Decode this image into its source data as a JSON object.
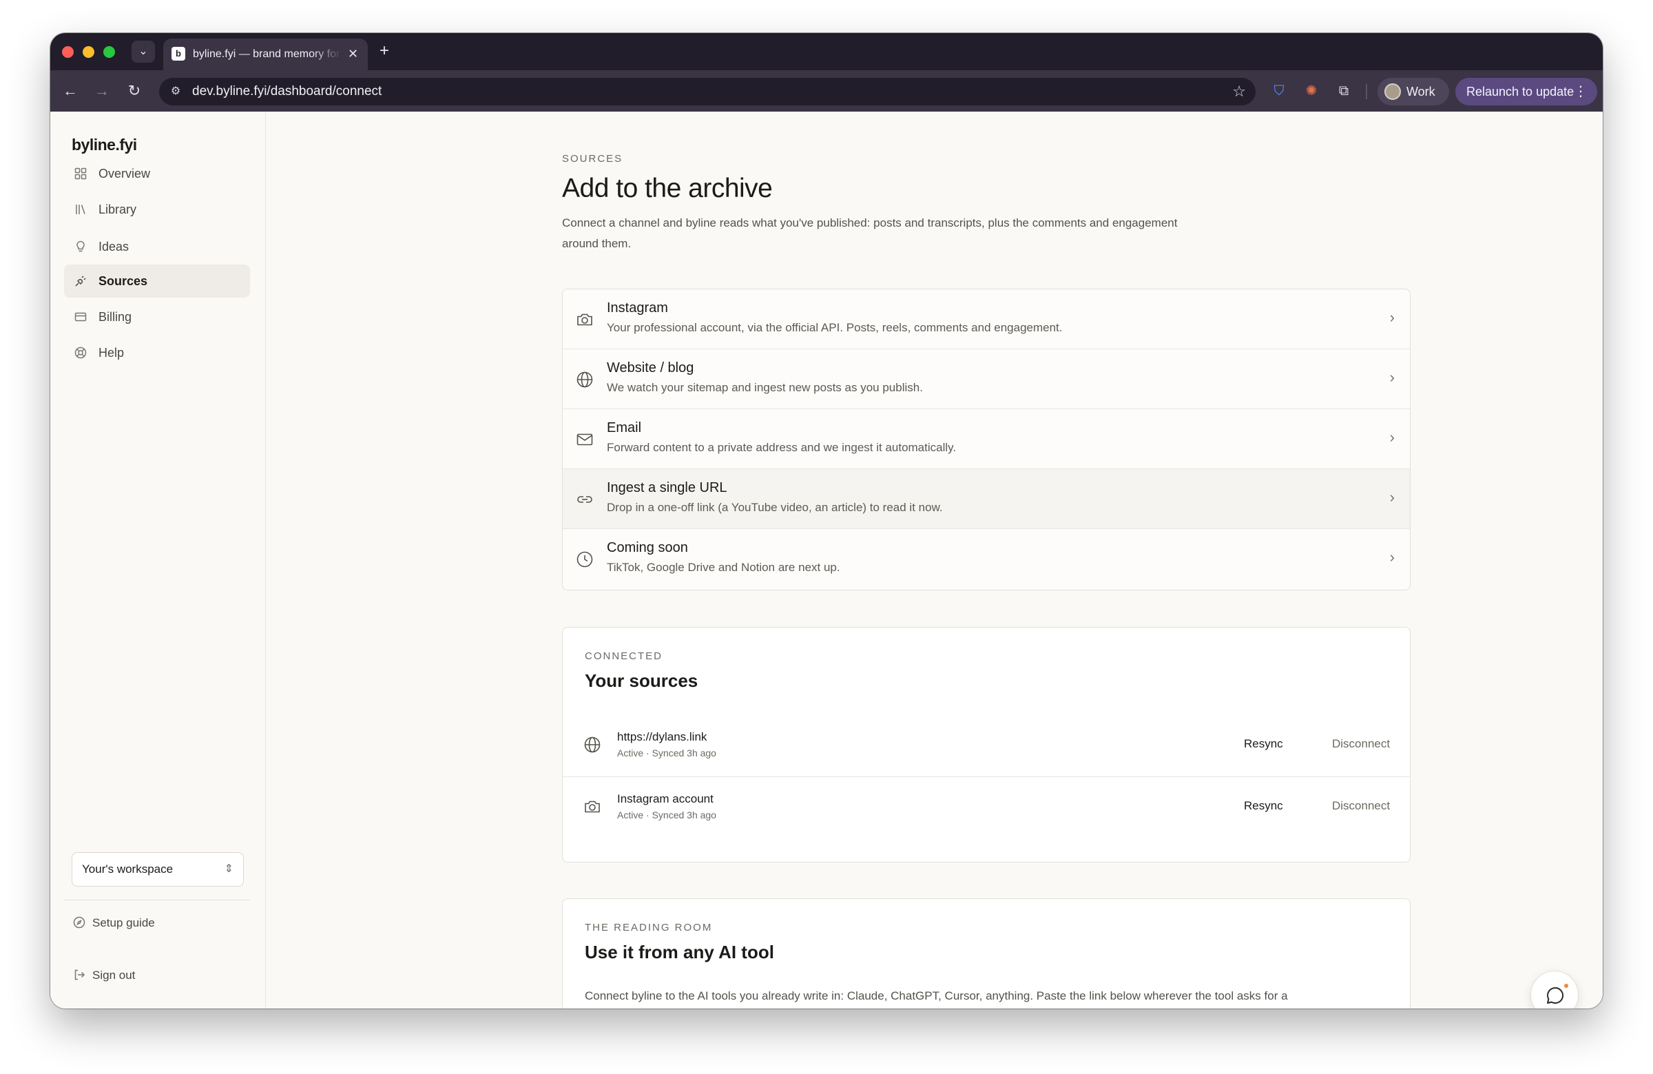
{
  "browser": {
    "tab_title": "byline.fyi — brand memory for creators",
    "favicon_letter": "b",
    "url": "dev.byline.fyi/dashboard/connect",
    "profile_label": "Work",
    "relaunch_label": "Relaunch to update"
  },
  "sidebar": {
    "brand": "byline.fyi",
    "items": [
      {
        "label": "Overview",
        "icon": "grid-icon"
      },
      {
        "label": "Library",
        "icon": "books-icon"
      },
      {
        "label": "Ideas",
        "icon": "lightbulb-icon"
      },
      {
        "label": "Sources",
        "icon": "plug-icon",
        "active": true
      },
      {
        "label": "Billing",
        "icon": "credit-card-icon"
      },
      {
        "label": "Help",
        "icon": "lifebuoy-icon"
      }
    ],
    "workspace": "Your's workspace",
    "setup_guide": "Setup guide",
    "sign_out": "Sign out"
  },
  "page": {
    "eyebrow": "SOURCES",
    "title": "Add to the archive",
    "intro": "Connect a channel and byline reads what you've published: posts and transcripts, plus the comments and engagement around them."
  },
  "sources": [
    {
      "title": "Instagram",
      "desc": "Your professional account, via the official API. Posts, reels, comments and engagement.",
      "icon": "camera-icon"
    },
    {
      "title": "Website / blog",
      "desc": "We watch your sitemap and ingest new posts as you publish.",
      "icon": "globe-icon"
    },
    {
      "title": "Email",
      "desc": "Forward content to a private address and we ingest it automatically.",
      "icon": "mail-icon"
    },
    {
      "title": "Ingest a single URL",
      "desc": "Drop in a one-off link (a YouTube video, an article) to read it now.",
      "icon": "link-icon"
    },
    {
      "title": "Coming soon",
      "desc": "TikTok, Google Drive and Notion are next up.",
      "icon": "clock-icon"
    }
  ],
  "connected": {
    "eyebrow": "CONNECTED",
    "title": "Your sources",
    "rows": [
      {
        "name": "https://dylans.link",
        "status": "Active · Synced 3h ago",
        "icon": "globe-icon",
        "resync": "Resync",
        "disconnect": "Disconnect"
      },
      {
        "name": "Instagram account",
        "status": "Active · Synced 3h ago",
        "icon": "camera-icon",
        "resync": "Resync",
        "disconnect": "Disconnect"
      }
    ]
  },
  "reading_room": {
    "eyebrow": "THE READING ROOM",
    "title": "Use it from any AI tool",
    "text": "Connect byline to the AI tools you already write in: Claude, ChatGPT, Cursor, anything. Paste the link below wherever the tool asks for a"
  },
  "colors": {
    "accent": "#5a4a80",
    "chrome_dark": "#221d2a",
    "page_bg": "#faf9f6",
    "notification_dot": "#f08a3c"
  }
}
